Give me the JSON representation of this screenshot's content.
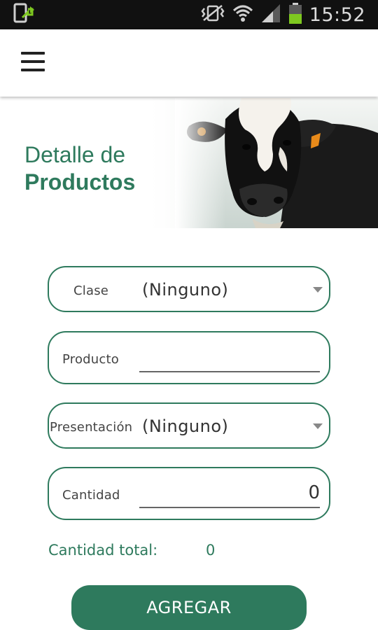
{
  "status_bar": {
    "time": "15:52",
    "icons": [
      "screen-share-icon",
      "vibrate-icon",
      "wifi-icon",
      "signal-icon",
      "battery-icon"
    ],
    "battery_color": "#7ec820"
  },
  "app_bar": {
    "menu_icon": "hamburger-menu-icon"
  },
  "banner": {
    "title_line1": "Detalle de",
    "title_line2": "Productos",
    "image": "cow-photo"
  },
  "form": {
    "clase": {
      "label": "Clase",
      "value": "(Ninguno)"
    },
    "producto": {
      "label": "Producto",
      "value": ""
    },
    "presentacion": {
      "label": "Presentación",
      "value": "(Ninguno)"
    },
    "cantidad": {
      "label": "Cantidad",
      "value": "0"
    },
    "total_label": "Cantidad total:",
    "total_value": "0",
    "submit_label": "AGREGAR"
  },
  "colors": {
    "accent": "#2e7a5d",
    "status_bar_bg": "#111111"
  }
}
